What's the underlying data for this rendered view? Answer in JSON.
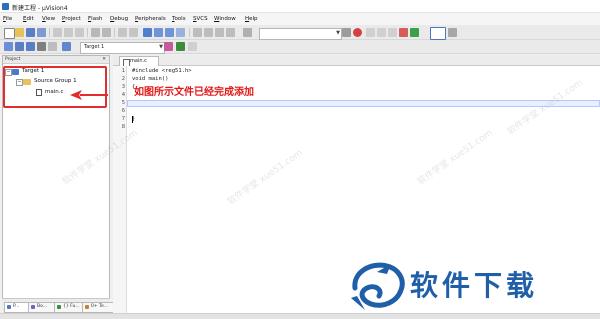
{
  "window": {
    "title": "新建工程 - µVision4"
  },
  "menu": [
    "File",
    "Edit",
    "View",
    "Project",
    "Flash",
    "Debug",
    "Peripherals",
    "Tools",
    "SVCS",
    "Window",
    "Help"
  ],
  "toolbar": {
    "target_select": "Target 1"
  },
  "project_panel": {
    "title": "Project",
    "close_glyph": "✕",
    "tree": {
      "expand_glyph": "−",
      "target": "Target 1",
      "group": "Source Group 1",
      "file": "main.c"
    },
    "bottom_tabs": [
      "P...",
      "Bo...",
      "{} Fu...",
      "0+ Te..."
    ]
  },
  "editor": {
    "tab": "main.c",
    "line_numbers": [
      "1",
      "2",
      "3",
      "4",
      "5",
      "6",
      "7",
      "8"
    ],
    "lines": [
      "#include <reg51.h>",
      "void main()",
      "{",
      "",
      "",
      "",
      "}",
      ""
    ]
  },
  "annotation": "如图所示文件已经完成添加",
  "watermark": {
    "small": "软件学堂 xue51.com",
    "brand": "软件下载"
  },
  "colors": {
    "highlight": "#e12d2d",
    "brand": "#1f5ea8"
  }
}
